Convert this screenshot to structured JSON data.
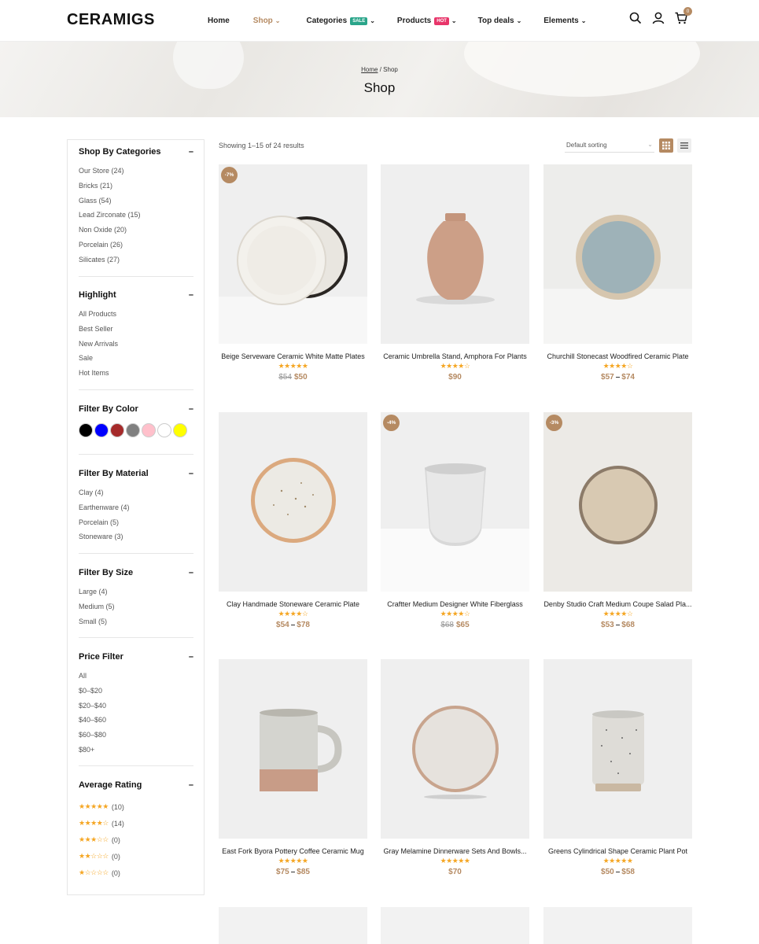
{
  "brand": {
    "logo": "CERAMIGS",
    "accent": "#b58a62"
  },
  "nav": {
    "items": [
      {
        "label": "Home",
        "active": false
      },
      {
        "label": "Shop",
        "active": true,
        "has_dropdown": true
      },
      {
        "label": "Categories",
        "badge": "SALE",
        "badge_color": "#2aa58a",
        "has_dropdown": true
      },
      {
        "label": "Products",
        "badge": "HOT",
        "badge_color": "#e8356a",
        "has_dropdown": true
      },
      {
        "label": "Top deals",
        "has_dropdown": true
      },
      {
        "label": "Elements",
        "has_dropdown": true
      }
    ],
    "icons": [
      "search-icon",
      "user-icon",
      "cart-icon"
    ],
    "cart_count": "0"
  },
  "banner": {
    "breadcrumb_home": "Home",
    "breadcrumb_sep": "/",
    "breadcrumb_current": "Shop",
    "title": "Shop"
  },
  "sidebar": {
    "categories": {
      "title": "Shop By Categories",
      "items": [
        "Our Store (24)",
        "Bricks (21)",
        "Glass (54)",
        "Lead Zirconate (15)",
        "Non Oxide (20)",
        "Porcelain (26)",
        "Silicates (27)"
      ]
    },
    "highlight": {
      "title": "Highlight",
      "items": [
        "All Products",
        "Best Seller",
        "New Arrivals",
        "Sale",
        "Hot Items"
      ]
    },
    "color": {
      "title": "Filter By Color",
      "swatches": [
        "#000000",
        "#0000ff",
        "#a52a2a",
        "#808080",
        "#ffc0cb",
        "#ffffff",
        "#ffff00"
      ]
    },
    "material": {
      "title": "Filter By Material",
      "items": [
        "Clay (4)",
        "Earthenware (4)",
        "Porcelain (5)",
        "Stoneware (3)"
      ]
    },
    "size": {
      "title": "Filter By Size",
      "items": [
        "Large (4)",
        "Medium (5)",
        "Small (5)"
      ]
    },
    "price": {
      "title": "Price Filter",
      "items": [
        "All",
        "$0–$20",
        "$20–$40",
        "$40–$60",
        "$60–$80",
        "$80+"
      ]
    },
    "rating": {
      "title": "Average Rating",
      "items": [
        {
          "stars": "★★★★★",
          "count": "(10)"
        },
        {
          "stars": "★★★★☆",
          "count": "(14)"
        },
        {
          "stars": "★★★☆☆",
          "count": "(0)"
        },
        {
          "stars": "★★☆☆☆",
          "count": "(0)"
        },
        {
          "stars": "★☆☆☆☆",
          "count": "(0)"
        }
      ]
    },
    "collapse_symbol": "–"
  },
  "toolbar": {
    "result_count": "Showing 1–15 of 24 results",
    "sort_value": "Default sorting",
    "view_grid": "grid-view-icon",
    "view_list": "list-view-icon"
  },
  "products": [
    {
      "name": "Beige Serveware Ceramic White Matte Plates",
      "badge": "-7%",
      "stars": "★★★★★",
      "price_old": "$54",
      "price": "$50",
      "image": "plates"
    },
    {
      "name": "Ceramic Umbrella Stand, Amphora For Plants",
      "stars": "★★★★☆",
      "price": "$90",
      "image": "amphora"
    },
    {
      "name": "Churchill Stonecast Woodfired Ceramic Plate",
      "stars": "★★★★☆",
      "price": "$57",
      "price_max": "$74",
      "image": "blue-plate"
    },
    {
      "name": "Clay Handmade Stoneware Ceramic Plate",
      "stars": "★★★★☆",
      "price": "$54",
      "price_max": "$78",
      "image": "speckled-plate"
    },
    {
      "name": "Craftter Medium Designer White Fiberglass",
      "badge": "-4%",
      "stars": "★★★★☆",
      "price_old": "$68",
      "price": "$65",
      "image": "white-pot"
    },
    {
      "name": "Denby Studio Craft Medium Coupe Salad Pla...",
      "badge": "-3%",
      "stars": "★★★★☆",
      "price": "$53",
      "price_max": "$68",
      "image": "tan-plate"
    },
    {
      "name": "East Fork Byora Pottery Coffee Ceramic Mug",
      "stars": "★★★★★",
      "price": "$75",
      "price_max": "$85",
      "image": "mug"
    },
    {
      "name": "Gray Melamine Dinnerware Sets And Bowls...",
      "stars": "★★★★★",
      "price": "$70",
      "image": "gray-plate"
    },
    {
      "name": "Greens Cylindrical Shape Ceramic Plant Pot",
      "stars": "★★★★★",
      "price": "$50",
      "price_max": "$58",
      "image": "speckled-cup"
    }
  ]
}
